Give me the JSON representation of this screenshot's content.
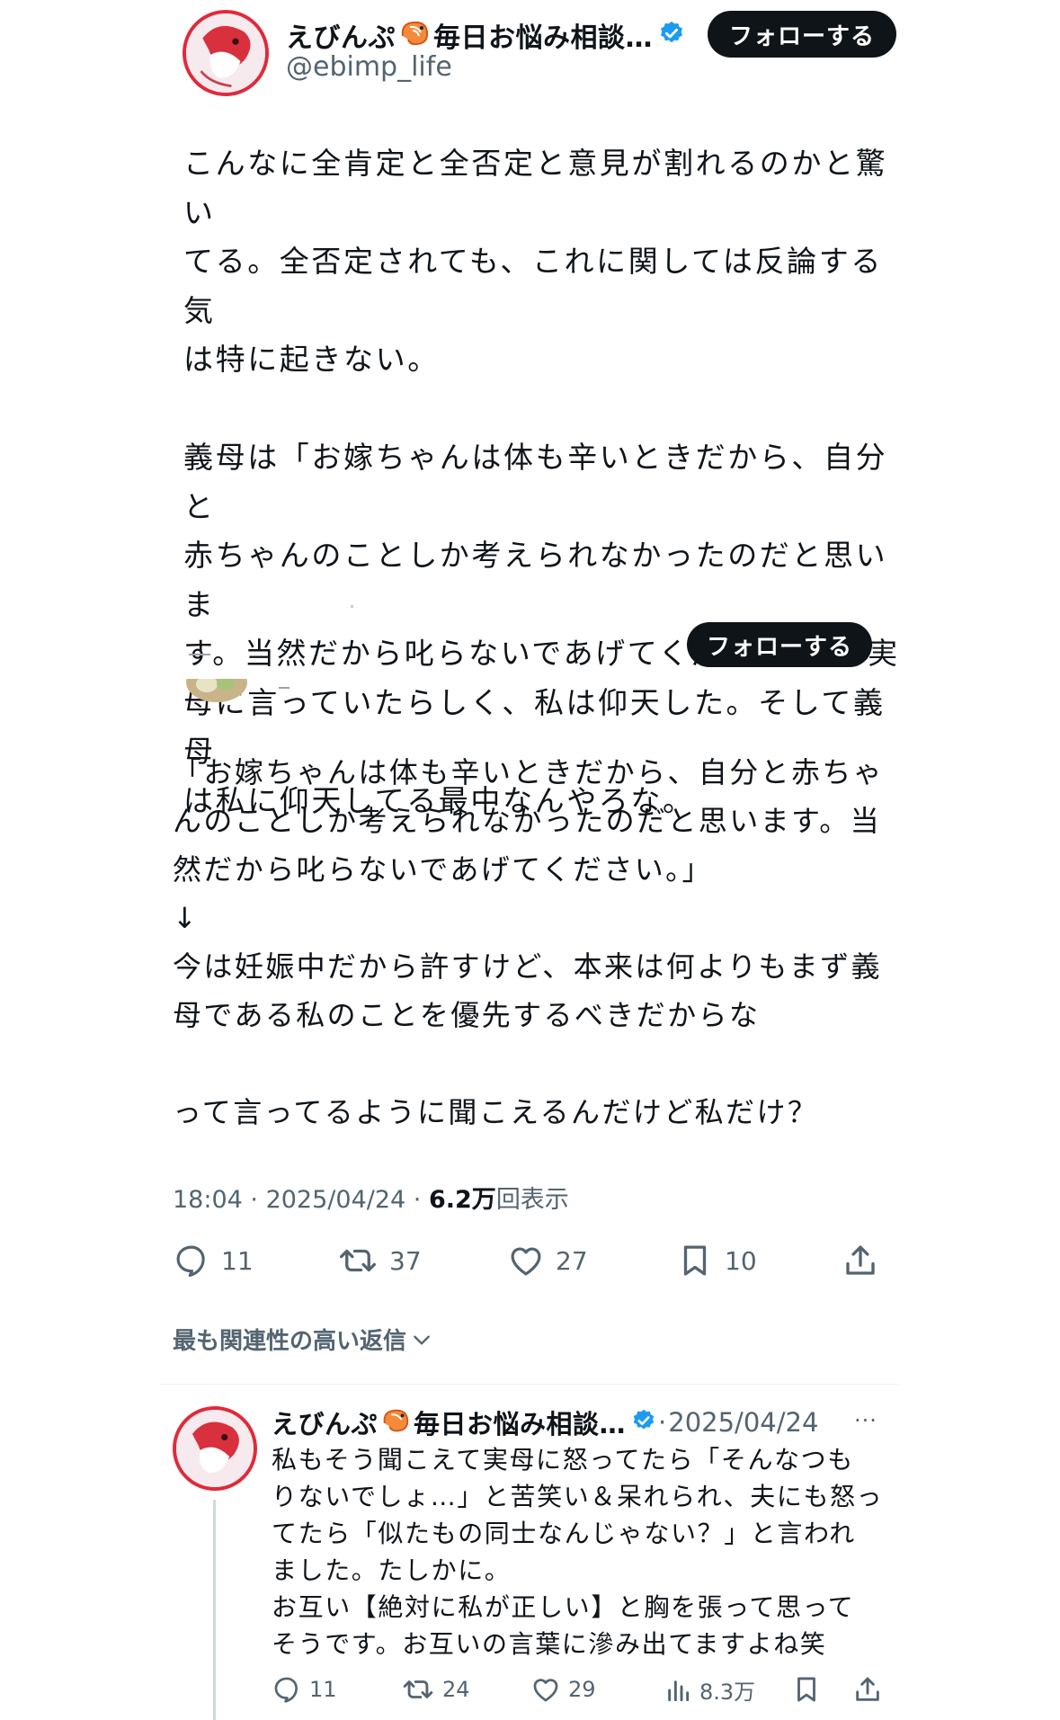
{
  "tweet": {
    "author_name": "えびんぷ",
    "author_name_suffix": "毎日お悩み相談…",
    "handle": "@ebimp_life",
    "follow_label": "フォローする",
    "text": "こんなに全肯定と全否定と意見が割れるのかと驚い\nてる。全否定されても、これに関しては反論する気\nは特に起きない。\n\n義母は「お嫁ちゃんは体も辛いときだから、自分と\n赤ちゃんのことしか考えられなかったのだと思いま\nす。当然だから叱らないであげてください。」と実\n母に言っていたらしく、私は仰天した。そして義母\nは私に仰天してる最中なんやろな。",
    "time": "18:04",
    "date": "2025/04/24",
    "views_value": "6.2万",
    "views_label": "回表示",
    "replies": "11",
    "retweets": "37",
    "likes": "27",
    "bookmarks": "10"
  },
  "quoted": {
    "follow_label": "フォローする",
    "text": "「お嫁ちゃんは体も辛いときだから、自分と赤ちゃ\nんのことしか考えられなかったのだと思います。当\n然だから叱らないであげてください。」\n↓\n今は妊娠中だから許すけど、本来は何よりもまず義\n母である私のことを優先するべきだからな\n\nって言ってるように聞こえるんだけど私だけ？"
  },
  "sort_label": "最も関連性の高い返信",
  "reply": {
    "author_name": "えびんぷ",
    "author_name_suffix": "毎日お悩み相談…",
    "separator": "·",
    "date": "2025/04/24",
    "more": "···",
    "text": "私もそう聞こえて実母に怒ってたら「そんなつも\nりないでしょ…」と苦笑い＆呆れられ、夫にも怒っ\nてたら「似たもの同士なんじゃない？」と言われ\nました。たしかに。\nお互い【絶対に私が正しい】と胸を張って思って\nそうです。お互いの言葉に滲み出てますよね笑",
    "replies": "11",
    "retweets": "24",
    "likes": "29",
    "views": "8.3万"
  },
  "colors": {
    "text": "#0f1419",
    "muted": "#536471",
    "verified": "#1d9bf0",
    "avatar_ring": "#e02a3a",
    "button": "#0f1419"
  },
  "icons": [
    "verified-badge-icon",
    "shrimp-emoji-icon",
    "reply-icon",
    "retweet-icon",
    "like-icon",
    "bookmark-icon",
    "share-icon",
    "views-icon",
    "chevron-down-icon",
    "more-icon"
  ]
}
